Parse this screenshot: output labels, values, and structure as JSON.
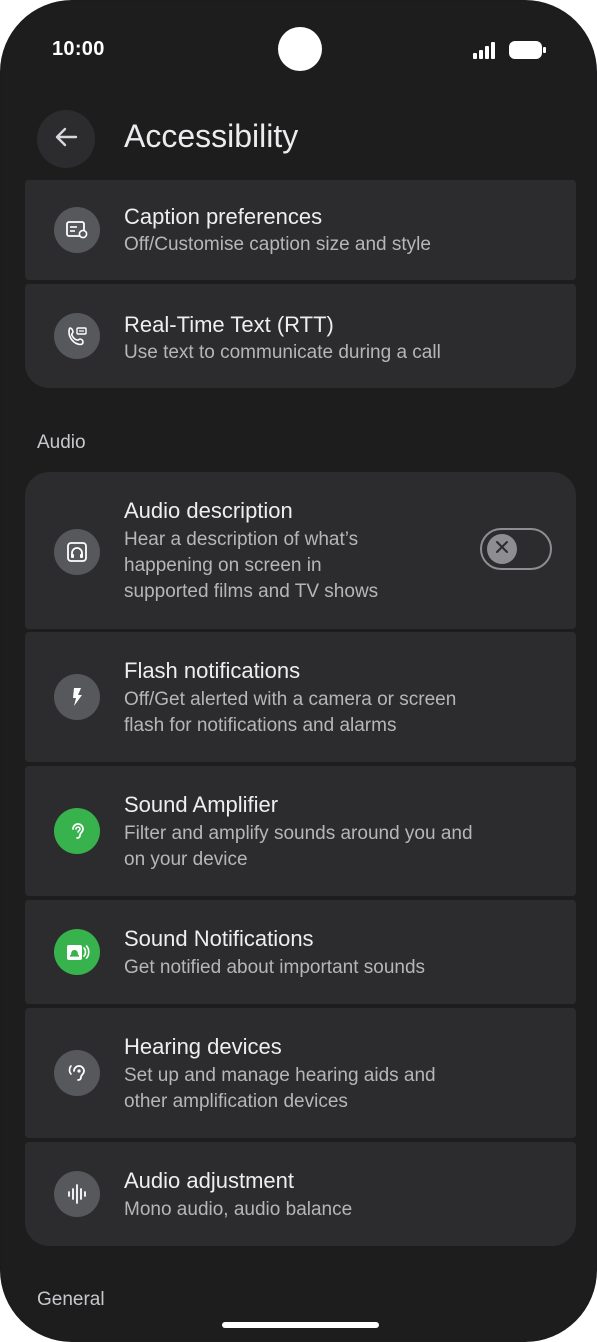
{
  "status_bar": {
    "time": "10:00"
  },
  "app_bar": {
    "title": "Accessibility"
  },
  "items_top": [
    {
      "title": "Caption preferences",
      "subtitle": "Off/Customise caption size and style",
      "icon": "caption-icon"
    },
    {
      "title": "Real-Time Text (RTT)",
      "subtitle": "Use text to communicate during a call",
      "icon": "rtt-phone-icon"
    }
  ],
  "sections": {
    "audio": "Audio",
    "general": "General"
  },
  "audio_items": [
    {
      "title": "Audio description",
      "subtitle": "Hear a description of what’s\nhappening on screen in\nsupported films and TV shows",
      "icon": "headphones-icon",
      "toggle": "off"
    },
    {
      "title": "Flash notifications",
      "subtitle": "Off/Get alerted with a camera or screen\nflash for notifications and alarms",
      "icon": "flash-icon"
    },
    {
      "title": "Sound Amplifier",
      "subtitle": "Filter and amplify sounds around you and\non your device",
      "icon": "ear-amplifier-icon"
    },
    {
      "title": "Sound Notifications",
      "subtitle": "Get notified about important sounds",
      "icon": "sound-notifications-icon"
    },
    {
      "title": "Hearing devices",
      "subtitle": "Set up and manage hearing aids and\nother amplification devices",
      "icon": "hearing-device-icon"
    },
    {
      "title": "Audio adjustment",
      "subtitle": "Mono audio, audio balance",
      "icon": "waveform-icon"
    }
  ],
  "colors": {
    "background": "#1d1d1e",
    "card": "#2c2c2e",
    "icon_bg": "#57585c",
    "accent_green": "#37b24d"
  }
}
